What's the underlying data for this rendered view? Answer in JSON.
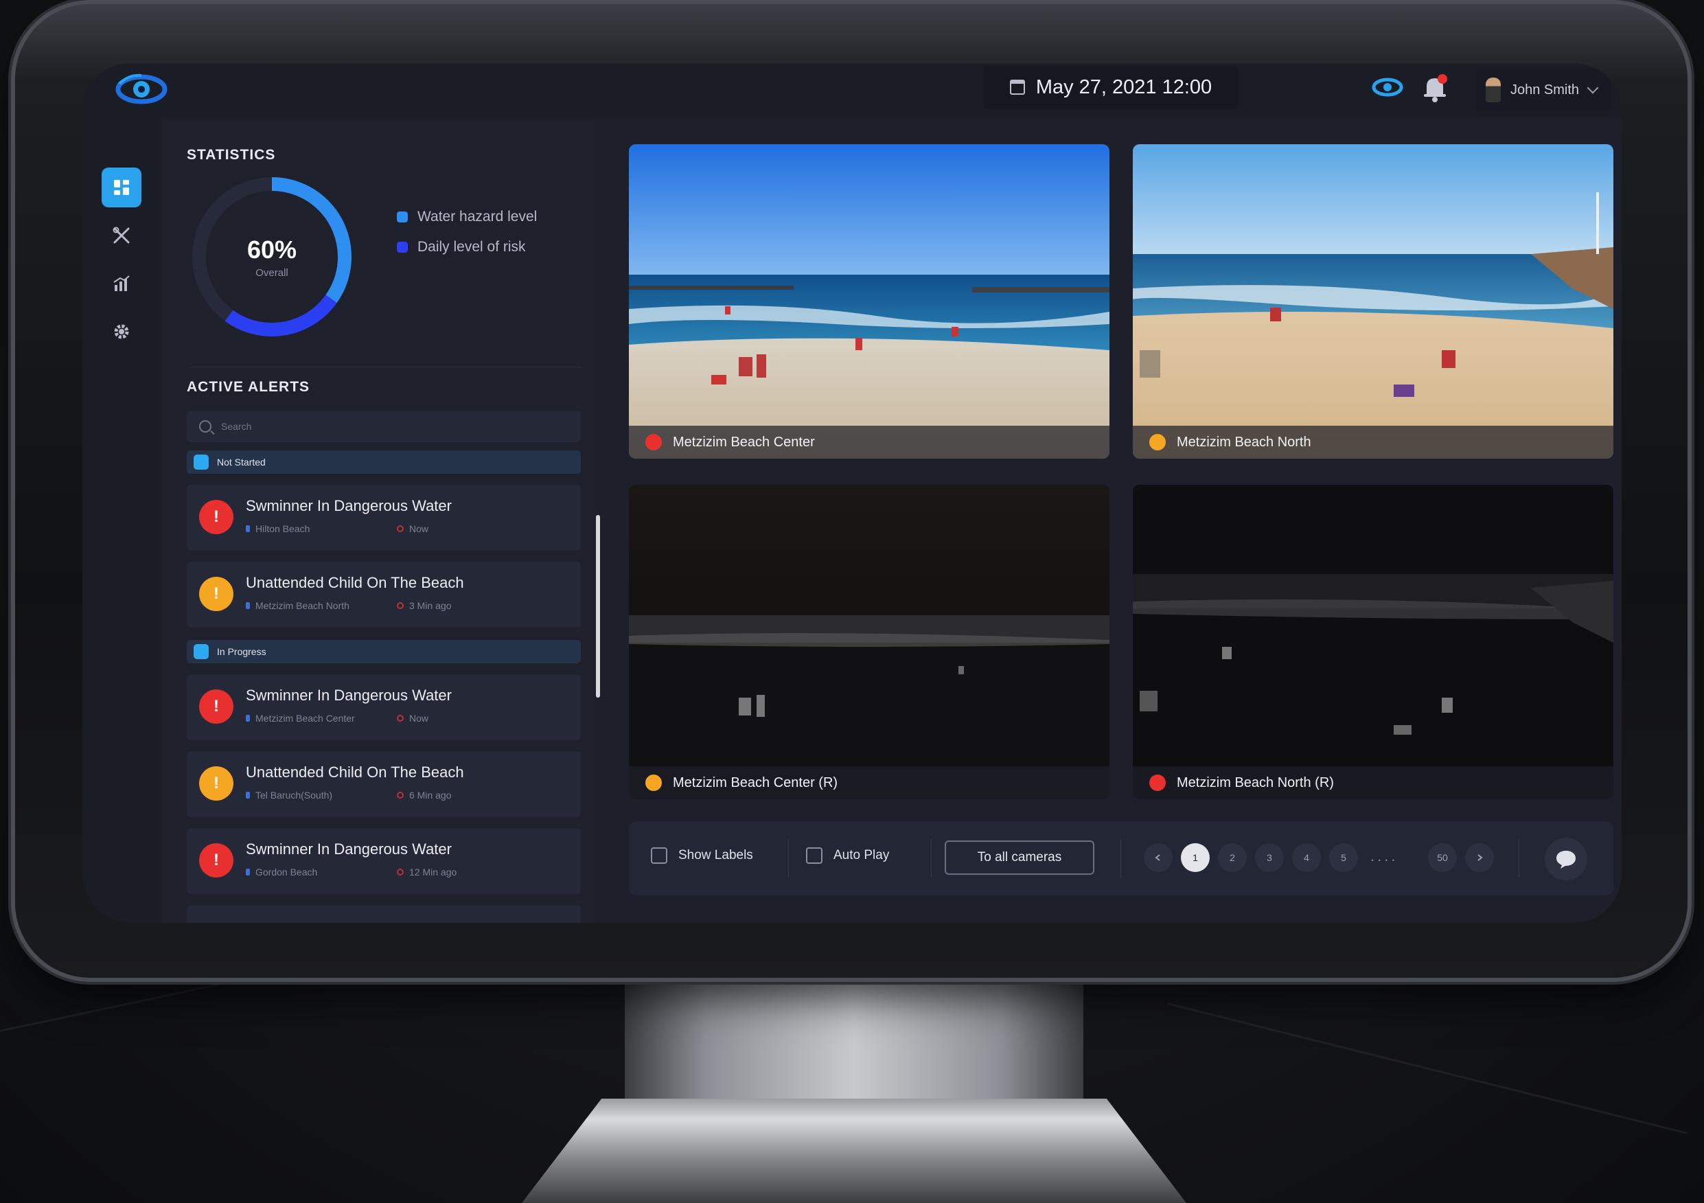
{
  "header": {
    "datetime": "May 27, 2021 12:00",
    "user_name": "John Smith",
    "icons": [
      "eye-logo-icon",
      "calendar-icon",
      "eye-icon",
      "bell-icon",
      "chevron-down-icon"
    ]
  },
  "sidebar": {
    "items": [
      {
        "icon": "dashboard-icon",
        "active": true
      },
      {
        "icon": "tools-icon",
        "active": false
      },
      {
        "icon": "chart-icon",
        "active": false
      },
      {
        "icon": "gear-icon",
        "active": false
      }
    ]
  },
  "statistics": {
    "title": "STATISTICS",
    "percent_label": "60%",
    "percent_value": 60,
    "sub_label": "Overall",
    "legend": [
      {
        "label": "Water hazard level",
        "color": "#2f8ff0"
      },
      {
        "label": "Daily level of risk",
        "color": "#2b3ff2"
      }
    ]
  },
  "alerts": {
    "title": "ACTIVE ALERTS",
    "search_placeholder": "Search",
    "groups": [
      {
        "label": "Not Started",
        "items": [
          {
            "title": "Swminner In Dangerous Water",
            "location": "Hilton Beach",
            "time": "Now",
            "severity": "high"
          },
          {
            "title": "Unattended Child On The Beach",
            "location": "Metzizim Beach North",
            "time": "3 Min ago",
            "severity": "medium"
          }
        ]
      },
      {
        "label": "In Progress",
        "items": [
          {
            "title": "Swminner In Dangerous Water",
            "location": "Metzizim Beach Center",
            "time": "Now",
            "severity": "high"
          },
          {
            "title": "Unattended Child On The Beach",
            "location": "Tel Baruch(South)",
            "time": "6 Min ago",
            "severity": "medium"
          },
          {
            "title": "Swminner In Dangerous Water",
            "location": "Gordon Beach",
            "time": "12 Min ago",
            "severity": "high"
          }
        ]
      }
    ]
  },
  "cameras": [
    {
      "name": "Metzizim Beach Center",
      "status": "high",
      "mode": "day"
    },
    {
      "name": "Metzizim Beach North",
      "status": "medium",
      "mode": "day"
    },
    {
      "name": "Metzizim Beach Center (R)",
      "status": "medium",
      "mode": "night"
    },
    {
      "name": "Metzizim Beach North (R)",
      "status": "high",
      "mode": "night"
    }
  ],
  "toolbar": {
    "show_labels": "Show Labels",
    "auto_play": "Auto Play",
    "to_all_cameras": "To all cameras",
    "pages": [
      "1",
      "2",
      "3",
      "4",
      "5"
    ],
    "ellipsis": "....",
    "last_page": "50",
    "current_page": "1"
  },
  "colors": {
    "accent": "#2aa2ee",
    "danger": "#e8312f",
    "warning": "#f5a623",
    "panel": "#1e202c"
  }
}
